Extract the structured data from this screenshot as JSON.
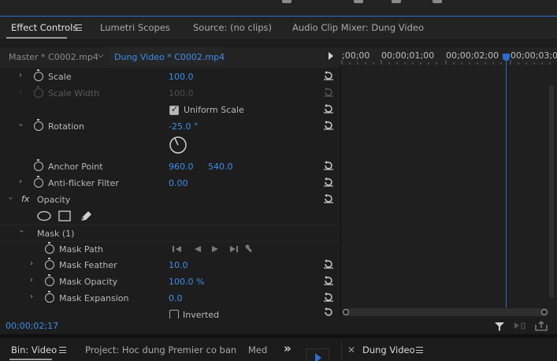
{
  "tabs": {
    "effect_controls": "Effect Controls",
    "lumetri": "Lumetri Scopes",
    "source": "Source: (no clips)",
    "audio_mixer": "Audio Clip Mixer: Dung Video"
  },
  "source_bar": {
    "master": "Master * C0002.mp4",
    "clip": "Dung Video * C0002.mp4"
  },
  "properties": {
    "scale": {
      "label": "Scale",
      "value": "100.0"
    },
    "scale_width": {
      "label": "Scale Width",
      "value": "100.0"
    },
    "uniform_scale": {
      "label": "Uniform Scale",
      "checked": true
    },
    "rotation": {
      "label": "Rotation",
      "value": "-25.0 °"
    },
    "anchor_point": {
      "label": "Anchor Point",
      "x": "960.0",
      "y": "540.0"
    },
    "anti_flicker": {
      "label": "Anti-flicker Filter",
      "value": "0.00"
    },
    "opacity": {
      "fx": "fx",
      "label": "Opacity"
    },
    "mask": {
      "label": "Mask (1)"
    },
    "mask_path": {
      "label": "Mask Path"
    },
    "mask_feather": {
      "label": "Mask Feather",
      "value": "10.0"
    },
    "mask_opacity": {
      "label": "Mask Opacity",
      "value": "100.0 %"
    },
    "mask_expansion": {
      "label": "Mask Expansion",
      "value": "0.0"
    },
    "inverted": {
      "label": "Inverted",
      "checked": false
    }
  },
  "timeline": {
    "ticks": [
      ";00;00",
      "00;00;01;00",
      "00;00;02;00",
      "00;00;03;0"
    ]
  },
  "footer": {
    "timecode": "00;00;02;17"
  },
  "bottom_tabs": {
    "bin": "Bin: Video",
    "project": "Project: Hoc dung Premier co ban",
    "media": "Med",
    "overflow": "»",
    "sequence": "Dung Video"
  },
  "colors": {
    "accent": "#2b6ed1",
    "value_blue": "#3d8fe8",
    "panel_bg": "#1d1d1d"
  }
}
